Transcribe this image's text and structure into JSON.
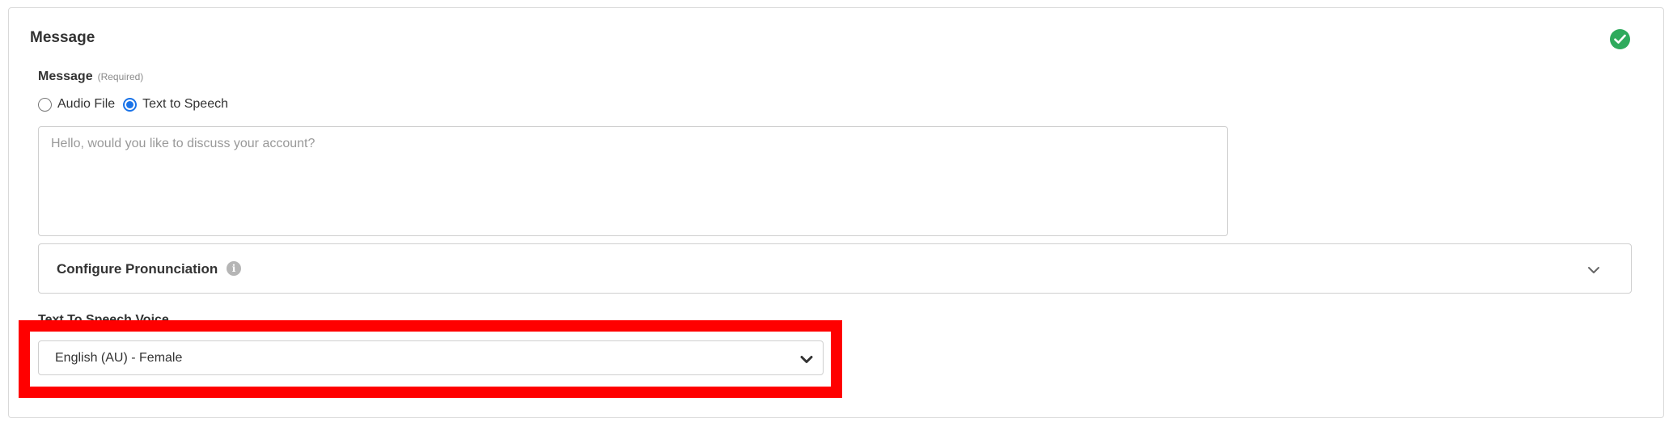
{
  "section": {
    "title": "Message",
    "status_icon": "check-circle-icon",
    "status_color": "#2eaa5c"
  },
  "message": {
    "label": "Message",
    "required_hint": "(Required)",
    "source_options": [
      {
        "label": "Audio File",
        "checked": false
      },
      {
        "label": "Text to Speech",
        "checked": true
      }
    ],
    "text_value": "",
    "placeholder": "Hello, would you like to discuss your account?"
  },
  "pronunciation": {
    "label": "Configure Pronunciation",
    "info_icon": "info-icon",
    "expand_icon": "chevron-down-icon"
  },
  "tts_voice": {
    "label": "Text To Speech Voice",
    "selected": "English (AU) - Female",
    "dropdown_icon": "chevron-down-icon"
  },
  "highlight": {
    "color": "#ff0000"
  },
  "accent_color": "#1a73e8"
}
